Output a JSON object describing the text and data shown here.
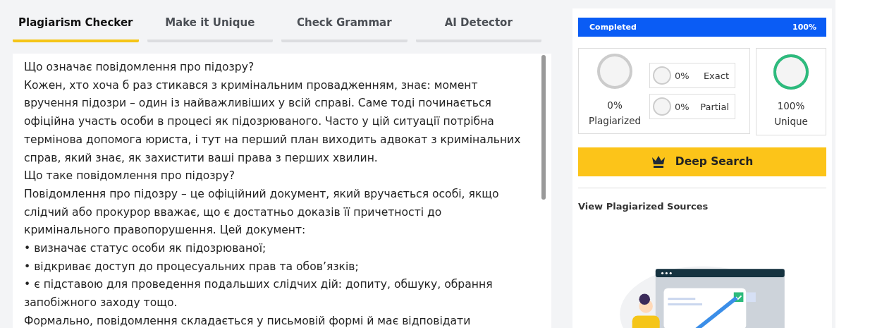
{
  "tabs": [
    {
      "label": "Plagiarism Checker",
      "selected": true
    },
    {
      "label": "Make it Unique",
      "selected": false
    },
    {
      "label": "Check Grammar",
      "selected": false
    },
    {
      "label": "AI Detector",
      "selected": false
    }
  ],
  "document": {
    "paragraphs": [
      "Що означає повідомлення про підозру?",
      "Кожен, хто хоча б раз стикався з кримінальним провадженням, знає: момент вручення підозри – один із найважливіших у всій справі. Саме тоді починається офіційна участь особи в процесі як підозрюваного. Часто у цій ситуації потрібна термінова допомога юриста, і тут на перший план виходить адвокат з кримінальних справ, який знає, як захистити ваші права з перших хвилин.",
      "Що таке повідомлення про підозру?",
      "Повідомлення про підозру – це офіційний документ, який вручається особі, якщо слідчий або прокурор вважає, що є достатньо доказів її причетності до кримінального правопорушення. Цей документ:",
      "• визначає статус особи як підозрюваної;",
      "• відкриває доступ до процесуальних прав та обов’язків;",
      "• є підставою для проведення подальших слідчих дій: допиту, обшуку, обрання запобіжного заходу тощо.",
      "Формально, повідомлення складається у письмовій формі й має відповідати"
    ]
  },
  "results": {
    "progress": {
      "label": "Completed",
      "reading": "100%",
      "level": 1
    },
    "plagiarized": {
      "value": "0%",
      "label": "Plagiarized",
      "level": 0
    },
    "breakdown": [
      {
        "value": "0%",
        "label": "Exact",
        "level": 0
      },
      {
        "value": "0%",
        "label": "Partial",
        "level": 0
      }
    ],
    "unique": {
      "value": "100%",
      "label": "Unique",
      "level": 1
    },
    "deep_search_button": "Deep Search",
    "sources_title": "View Plagiarized Sources"
  }
}
